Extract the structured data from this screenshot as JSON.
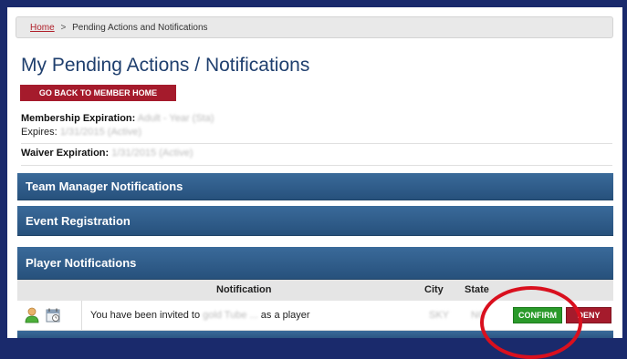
{
  "breadcrumb": {
    "home": "Home",
    "separator": ">",
    "current": "Pending Actions and Notifications"
  },
  "page": {
    "title": "My Pending Actions / Notifications"
  },
  "back_button": {
    "label": "GO BACK TO MEMBER HOME"
  },
  "membership": {
    "label": "Membership Expiration:",
    "value": "Adult - Year (Sta)",
    "expires_label": "Expires:",
    "expires_value": "1/31/2015 (Active)"
  },
  "waiver": {
    "label": "Waiver Expiration:",
    "value": "1/31/2015 (Active)"
  },
  "sections": {
    "team_manager": "Team Manager Notifications",
    "event_registration": "Event Registration",
    "player": "Player Notifications"
  },
  "table": {
    "headers": {
      "notification": "Notification",
      "city": "City",
      "state": "State"
    },
    "rows": [
      {
        "message": "You have been invited to",
        "team": "gold Tube ...",
        "suffix": "as a player",
        "city": "SKY",
        "state": "NC",
        "confirm": "CONFIRM",
        "deny": "DENY"
      }
    ]
  },
  "icons": {
    "user": "user-icon",
    "calendar": "calendar-icon"
  },
  "colors": {
    "brand_red": "#a51b2c",
    "section_blue": "#2f5e8e",
    "confirm_green": "#2a9a2a",
    "annotation_red": "#d9101e",
    "title_blue": "#1f3f6e"
  }
}
